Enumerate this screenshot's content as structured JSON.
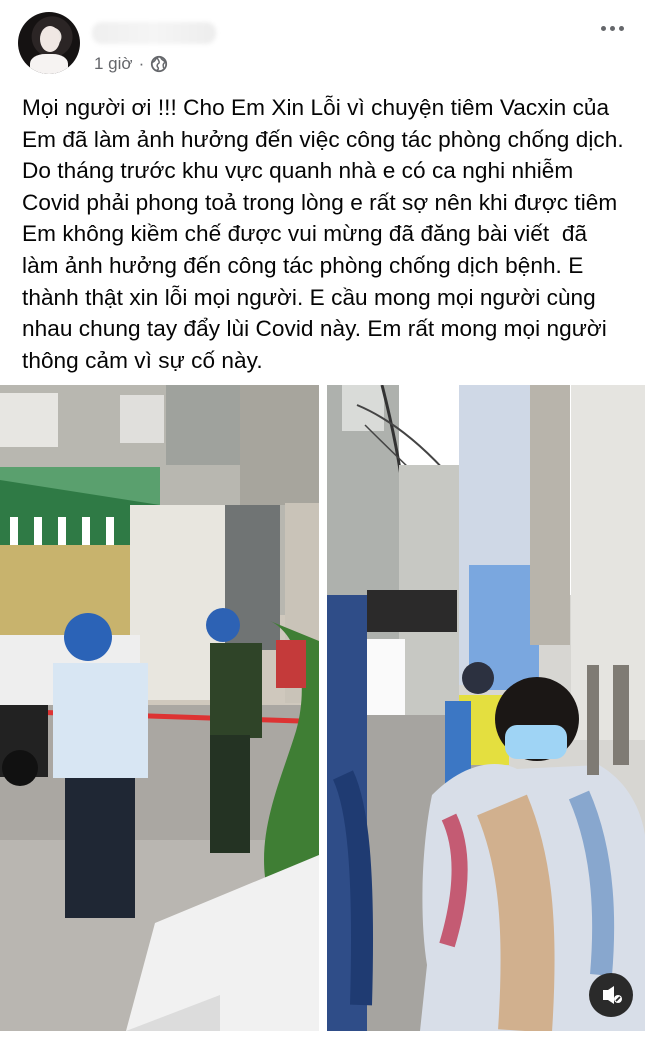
{
  "post": {
    "timestamp": "1 giờ",
    "separator": "·",
    "privacy_icon": "globe-icon",
    "more_icon": "more-options-icon",
    "text": "Mọi người ơi !!! Cho Em Xin Lỗi vì chuyện tiêm Vacxin của Em đã làm ảnh hưởng đến việc công tác phòng chống dịch.  Do tháng trước khu vực quanh nhà e có ca nghi nhiễm Covid phải phong toả trong lòng e rất sợ nên khi được tiêm Em không kiềm chế được vui mừng đã đăng bài viết  đã làm ảnh hưởng đến công tác phòng chống dịch bệnh. E thành thật xin lỗi mọi người. E cầu mong mọi người cùng nhau chung tay đẩy lùi Covid này. Em rất mong mọi người thông cảm vì sự cố này."
  },
  "media": {
    "photos": 2,
    "audio_icon": "mute-audio-icon"
  },
  "colors": {
    "meta_text": "#65676b",
    "text": "#050505",
    "background": "#ffffff"
  }
}
